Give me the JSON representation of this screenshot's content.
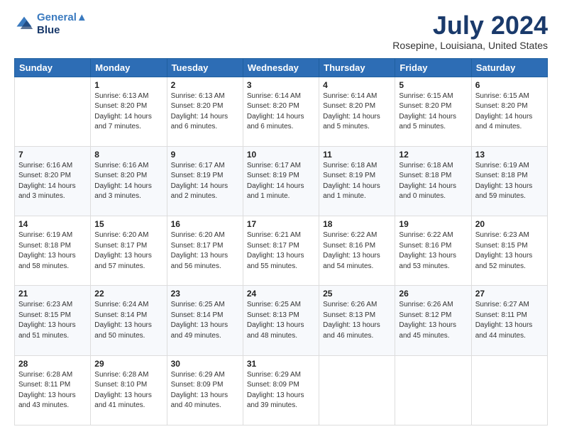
{
  "header": {
    "logo_line1": "General",
    "logo_line2": "Blue",
    "month_title": "July 2024",
    "location": "Rosepine, Louisiana, United States"
  },
  "days_of_week": [
    "Sunday",
    "Monday",
    "Tuesday",
    "Wednesday",
    "Thursday",
    "Friday",
    "Saturday"
  ],
  "weeks": [
    [
      {
        "day": "",
        "sunrise": "",
        "sunset": "",
        "daylight": ""
      },
      {
        "day": "1",
        "sunrise": "Sunrise: 6:13 AM",
        "sunset": "Sunset: 8:20 PM",
        "daylight": "Daylight: 14 hours and 7 minutes."
      },
      {
        "day": "2",
        "sunrise": "Sunrise: 6:13 AM",
        "sunset": "Sunset: 8:20 PM",
        "daylight": "Daylight: 14 hours and 6 minutes."
      },
      {
        "day": "3",
        "sunrise": "Sunrise: 6:14 AM",
        "sunset": "Sunset: 8:20 PM",
        "daylight": "Daylight: 14 hours and 6 minutes."
      },
      {
        "day": "4",
        "sunrise": "Sunrise: 6:14 AM",
        "sunset": "Sunset: 8:20 PM",
        "daylight": "Daylight: 14 hours and 5 minutes."
      },
      {
        "day": "5",
        "sunrise": "Sunrise: 6:15 AM",
        "sunset": "Sunset: 8:20 PM",
        "daylight": "Daylight: 14 hours and 5 minutes."
      },
      {
        "day": "6",
        "sunrise": "Sunrise: 6:15 AM",
        "sunset": "Sunset: 8:20 PM",
        "daylight": "Daylight: 14 hours and 4 minutes."
      }
    ],
    [
      {
        "day": "7",
        "sunrise": "Sunrise: 6:16 AM",
        "sunset": "Sunset: 8:20 PM",
        "daylight": "Daylight: 14 hours and 3 minutes."
      },
      {
        "day": "8",
        "sunrise": "Sunrise: 6:16 AM",
        "sunset": "Sunset: 8:20 PM",
        "daylight": "Daylight: 14 hours and 3 minutes."
      },
      {
        "day": "9",
        "sunrise": "Sunrise: 6:17 AM",
        "sunset": "Sunset: 8:19 PM",
        "daylight": "Daylight: 14 hours and 2 minutes."
      },
      {
        "day": "10",
        "sunrise": "Sunrise: 6:17 AM",
        "sunset": "Sunset: 8:19 PM",
        "daylight": "Daylight: 14 hours and 1 minute."
      },
      {
        "day": "11",
        "sunrise": "Sunrise: 6:18 AM",
        "sunset": "Sunset: 8:19 PM",
        "daylight": "Daylight: 14 hours and 1 minute."
      },
      {
        "day": "12",
        "sunrise": "Sunrise: 6:18 AM",
        "sunset": "Sunset: 8:18 PM",
        "daylight": "Daylight: 14 hours and 0 minutes."
      },
      {
        "day": "13",
        "sunrise": "Sunrise: 6:19 AM",
        "sunset": "Sunset: 8:18 PM",
        "daylight": "Daylight: 13 hours and 59 minutes."
      }
    ],
    [
      {
        "day": "14",
        "sunrise": "Sunrise: 6:19 AM",
        "sunset": "Sunset: 8:18 PM",
        "daylight": "Daylight: 13 hours and 58 minutes."
      },
      {
        "day": "15",
        "sunrise": "Sunrise: 6:20 AM",
        "sunset": "Sunset: 8:17 PM",
        "daylight": "Daylight: 13 hours and 57 minutes."
      },
      {
        "day": "16",
        "sunrise": "Sunrise: 6:20 AM",
        "sunset": "Sunset: 8:17 PM",
        "daylight": "Daylight: 13 hours and 56 minutes."
      },
      {
        "day": "17",
        "sunrise": "Sunrise: 6:21 AM",
        "sunset": "Sunset: 8:17 PM",
        "daylight": "Daylight: 13 hours and 55 minutes."
      },
      {
        "day": "18",
        "sunrise": "Sunrise: 6:22 AM",
        "sunset": "Sunset: 8:16 PM",
        "daylight": "Daylight: 13 hours and 54 minutes."
      },
      {
        "day": "19",
        "sunrise": "Sunrise: 6:22 AM",
        "sunset": "Sunset: 8:16 PM",
        "daylight": "Daylight: 13 hours and 53 minutes."
      },
      {
        "day": "20",
        "sunrise": "Sunrise: 6:23 AM",
        "sunset": "Sunset: 8:15 PM",
        "daylight": "Daylight: 13 hours and 52 minutes."
      }
    ],
    [
      {
        "day": "21",
        "sunrise": "Sunrise: 6:23 AM",
        "sunset": "Sunset: 8:15 PM",
        "daylight": "Daylight: 13 hours and 51 minutes."
      },
      {
        "day": "22",
        "sunrise": "Sunrise: 6:24 AM",
        "sunset": "Sunset: 8:14 PM",
        "daylight": "Daylight: 13 hours and 50 minutes."
      },
      {
        "day": "23",
        "sunrise": "Sunrise: 6:25 AM",
        "sunset": "Sunset: 8:14 PM",
        "daylight": "Daylight: 13 hours and 49 minutes."
      },
      {
        "day": "24",
        "sunrise": "Sunrise: 6:25 AM",
        "sunset": "Sunset: 8:13 PM",
        "daylight": "Daylight: 13 hours and 48 minutes."
      },
      {
        "day": "25",
        "sunrise": "Sunrise: 6:26 AM",
        "sunset": "Sunset: 8:13 PM",
        "daylight": "Daylight: 13 hours and 46 minutes."
      },
      {
        "day": "26",
        "sunrise": "Sunrise: 6:26 AM",
        "sunset": "Sunset: 8:12 PM",
        "daylight": "Daylight: 13 hours and 45 minutes."
      },
      {
        "day": "27",
        "sunrise": "Sunrise: 6:27 AM",
        "sunset": "Sunset: 8:11 PM",
        "daylight": "Daylight: 13 hours and 44 minutes."
      }
    ],
    [
      {
        "day": "28",
        "sunrise": "Sunrise: 6:28 AM",
        "sunset": "Sunset: 8:11 PM",
        "daylight": "Daylight: 13 hours and 43 minutes."
      },
      {
        "day": "29",
        "sunrise": "Sunrise: 6:28 AM",
        "sunset": "Sunset: 8:10 PM",
        "daylight": "Daylight: 13 hours and 41 minutes."
      },
      {
        "day": "30",
        "sunrise": "Sunrise: 6:29 AM",
        "sunset": "Sunset: 8:09 PM",
        "daylight": "Daylight: 13 hours and 40 minutes."
      },
      {
        "day": "31",
        "sunrise": "Sunrise: 6:29 AM",
        "sunset": "Sunset: 8:09 PM",
        "daylight": "Daylight: 13 hours and 39 minutes."
      },
      {
        "day": "",
        "sunrise": "",
        "sunset": "",
        "daylight": ""
      },
      {
        "day": "",
        "sunrise": "",
        "sunset": "",
        "daylight": ""
      },
      {
        "day": "",
        "sunrise": "",
        "sunset": "",
        "daylight": ""
      }
    ]
  ]
}
